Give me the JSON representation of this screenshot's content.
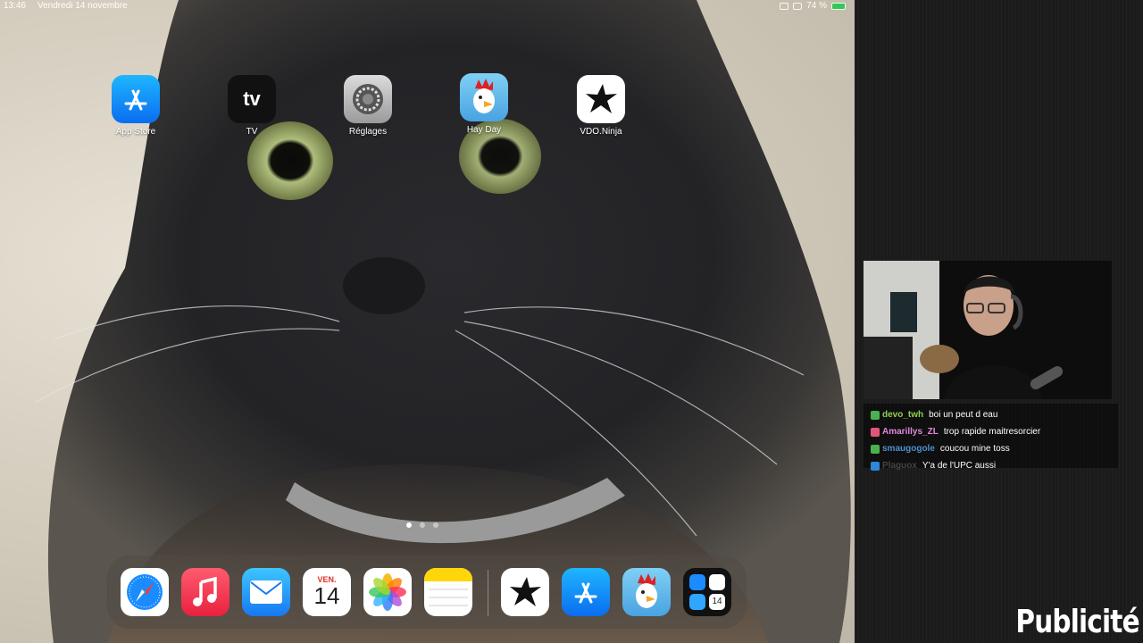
{
  "status_bar": {
    "time": "13:46",
    "date": "Vendredi 14 novembre",
    "battery": "74 %"
  },
  "home_apps": [
    {
      "label": "App Store",
      "icon": "app-store-icon"
    },
    {
      "label": "TV",
      "icon": "apple-tv-icon",
      "icon_text": "tv"
    },
    {
      "label": "Réglages",
      "icon": "settings-gear-icon"
    },
    {
      "label": "Hay Day",
      "icon": "hay-day-rooster-icon"
    },
    {
      "label": "VDO.Ninja",
      "icon": "vdo-ninja-star-icon"
    }
  ],
  "page_indicator": {
    "pages": 3,
    "current": 1
  },
  "dock": {
    "apps": [
      {
        "icon": "safari-compass-icon"
      },
      {
        "icon": "music-note-icon"
      },
      {
        "icon": "mail-envelope-icon"
      },
      {
        "icon": "calendar-icon",
        "day_name": "VEN.",
        "day_number": "14"
      },
      {
        "icon": "photos-flower-icon"
      },
      {
        "icon": "notes-icon"
      }
    ],
    "recent_apps": [
      {
        "icon": "vdo-ninja-star-icon"
      },
      {
        "icon": "app-store-icon"
      },
      {
        "icon": "hay-day-rooster-icon"
      },
      {
        "icon": "app-library-icon",
        "calendar_number": "14"
      }
    ]
  },
  "chat": {
    "messages": [
      {
        "user": "devo_twh",
        "text": "boi un peut d eau",
        "user_color": "#8fd14f",
        "badge_color": "#4caf50"
      },
      {
        "user": "Amarillys_ZL",
        "text": "trop rapide maitresorcier",
        "user_color": "#e08ad8",
        "badge_color": "#e0557a"
      },
      {
        "user": "smaugogole",
        "text": "coucou mine toss",
        "user_color": "#4f8fd1",
        "badge_color": "#4caf50"
      },
      {
        "user": "Plaguox",
        "text": "Y'a de l'UPC aussi",
        "user_color": "#444444",
        "badge_color": "#2f86d6"
      }
    ]
  },
  "overlay": {
    "ad_label": "Publicité"
  }
}
